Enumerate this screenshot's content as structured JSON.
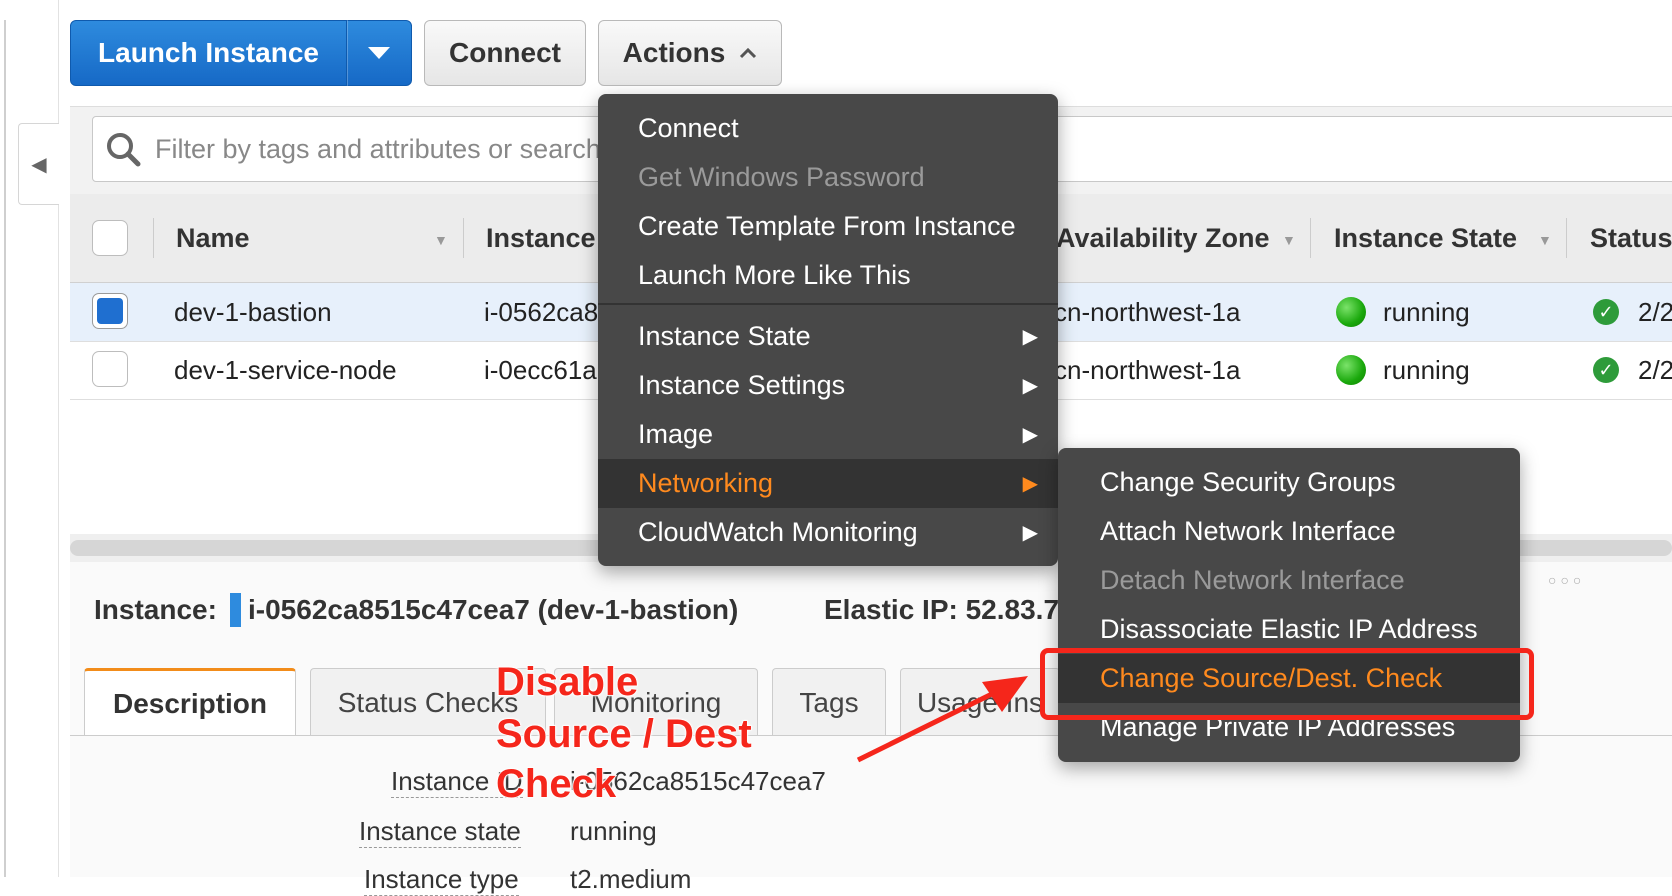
{
  "toolbar": {
    "launch_label": "Launch Instance",
    "connect_label": "Connect",
    "actions_label": "Actions"
  },
  "filter": {
    "placeholder": "Filter by tags and attributes or search"
  },
  "table": {
    "columns": [
      "Name",
      "Instance",
      "Availability Zone",
      "Instance State",
      "Status"
    ],
    "rows": [
      {
        "name": "dev-1-bastion",
        "instance_id": "i-0562ca8",
        "zone": "cn-northwest-1a",
        "state": "running",
        "status": "2/2",
        "selected": true
      },
      {
        "name": "dev-1-service-node",
        "instance_id": "i-0ecc61a",
        "zone": "cn-northwest-1a",
        "state": "running",
        "status": "2/2",
        "selected": false
      }
    ]
  },
  "details": {
    "instance_label": "Instance:",
    "instance_value": "i-0562ca8515c47cea7 (dev-1-bastion)",
    "elastic_ip_label": "Elastic IP: 52.83.7",
    "tabs": [
      "Description",
      "Status Checks",
      "Monitoring",
      "Tags",
      "Usage Ins"
    ],
    "fields": [
      {
        "label": "Instance ID",
        "value": "i-0562ca8515c47cea7"
      },
      {
        "label": "Instance state",
        "value": "running"
      },
      {
        "label": "Instance type",
        "value": "t2.medium"
      }
    ]
  },
  "actions_menu": {
    "items": [
      {
        "label": "Connect",
        "disabled": false
      },
      {
        "label": "Get Windows Password",
        "disabled": true
      },
      {
        "label": "Create Template From Instance",
        "disabled": false
      },
      {
        "label": "Launch More Like This",
        "disabled": false
      },
      {
        "label": "Instance State",
        "submenu": true
      },
      {
        "label": "Instance Settings",
        "submenu": true
      },
      {
        "label": "Image",
        "submenu": true
      },
      {
        "label": "Networking",
        "submenu": true,
        "highlighted": true
      },
      {
        "label": "CloudWatch Monitoring",
        "submenu": true
      }
    ]
  },
  "networking_menu": {
    "items": [
      {
        "label": "Change Security Groups",
        "disabled": false
      },
      {
        "label": "Attach Network Interface",
        "disabled": false
      },
      {
        "label": "Detach Network Interface",
        "disabled": true
      },
      {
        "label": "Disassociate Elastic IP Address",
        "disabled": false
      },
      {
        "label": "Change Source/Dest. Check",
        "highlighted": true
      },
      {
        "label": "Manage Private IP Addresses",
        "disabled": false
      }
    ]
  },
  "annotation": {
    "lines": [
      "Disable",
      "Source / Dest",
      "Check"
    ],
    "color": "#f5261b"
  },
  "colors": {
    "primary_button": "#1f6fd0",
    "menu_highlight": "#ff8a1e",
    "running": "#1aa80c"
  }
}
